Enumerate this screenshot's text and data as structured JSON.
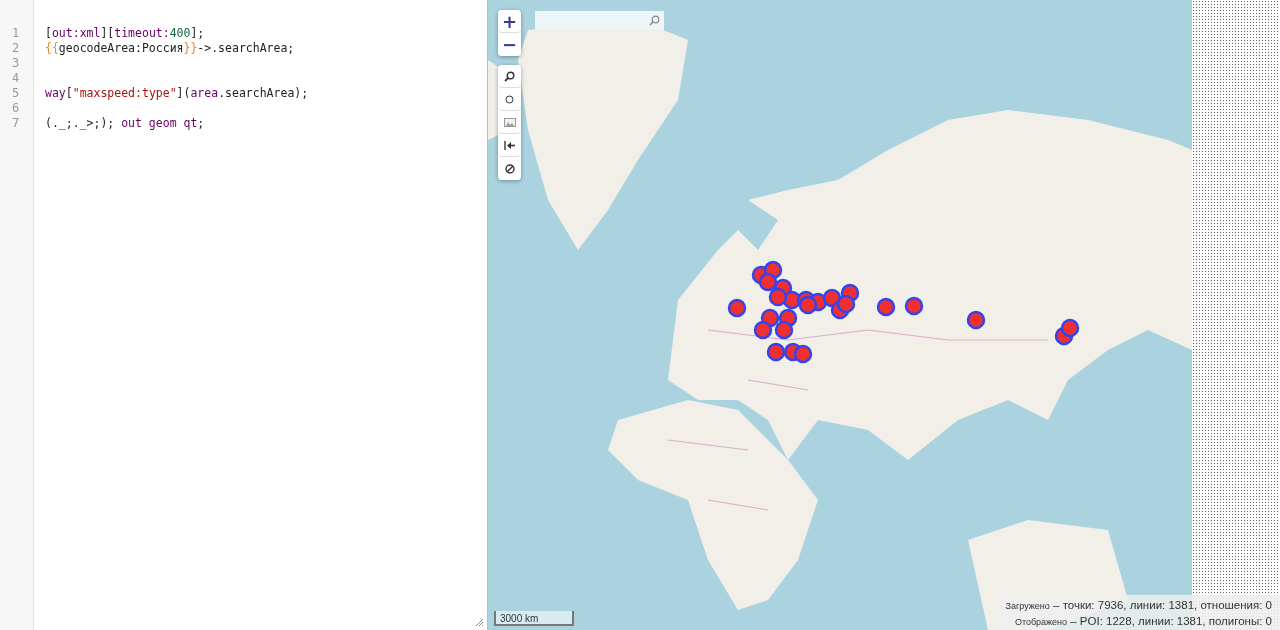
{
  "editor": {
    "lines": [
      {
        "number": "1",
        "tokens": [
          {
            "kind": "plain",
            "text": "["
          },
          {
            "kind": "keyword",
            "text": "out:xml"
          },
          {
            "kind": "plain",
            "text": "]["
          },
          {
            "kind": "keyword",
            "text": "timeout:"
          },
          {
            "kind": "number",
            "text": "400"
          },
          {
            "kind": "plain",
            "text": "];"
          }
        ]
      },
      {
        "number": "2",
        "tokens": [
          {
            "kind": "template",
            "text": "{{"
          },
          {
            "kind": "plain",
            "text": "geocodeArea:Россия"
          },
          {
            "kind": "template",
            "text": "}}"
          },
          {
            "kind": "plain",
            "text": "->.searchArea;"
          }
        ]
      },
      {
        "number": "3"
      },
      {
        "number": "4"
      },
      {
        "number": "5",
        "tokens": [
          {
            "kind": "keyword",
            "text": "way"
          },
          {
            "kind": "plain",
            "text": "["
          },
          {
            "kind": "string",
            "text": "\"maxspeed:type\""
          },
          {
            "kind": "plain",
            "text": "]("
          },
          {
            "kind": "keyword",
            "text": "area"
          },
          {
            "kind": "plain",
            "text": ".searchArea);"
          }
        ]
      },
      {
        "number": "6"
      },
      {
        "number": "7",
        "tokens": [
          {
            "kind": "plain",
            "text": "(._;._>;); "
          },
          {
            "kind": "keyword",
            "text": "out geom qt"
          },
          {
            "kind": "plain",
            "text": ";"
          }
        ]
      }
    ]
  },
  "map": {
    "zoom_in": "+",
    "zoom_out": "−",
    "scale": "3000 km",
    "status": [
      {
        "label": "Загружено",
        "value": "– точки: 7936, линии: 1381, отношения: 0"
      },
      {
        "label": "Отображено",
        "value": "– POI: 1228, линии: 1381, полигоны: 0"
      }
    ]
  }
}
